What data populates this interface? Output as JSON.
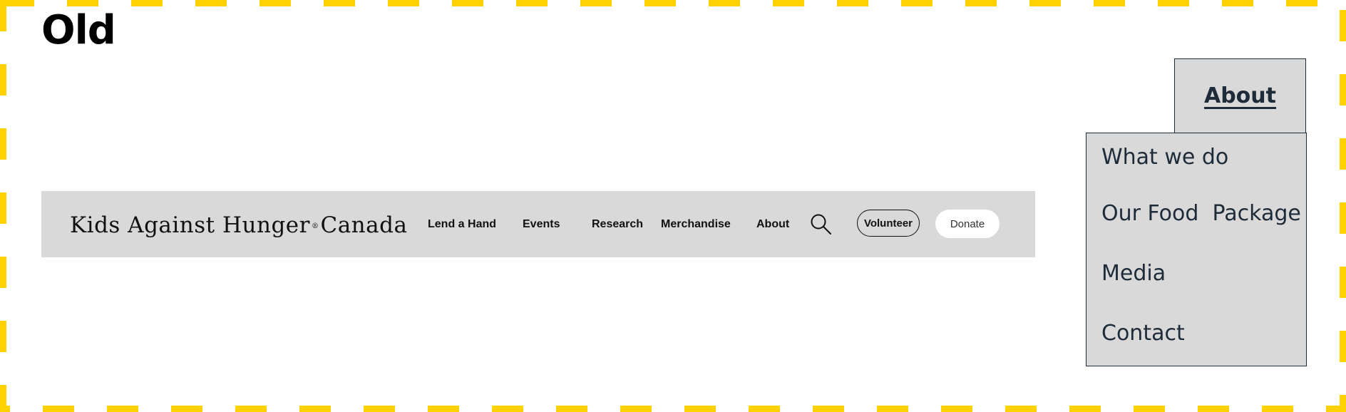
{
  "section_title": "Old",
  "navbar": {
    "logo_text_main": "Kids Against Hunger",
    "logo_mark": "®",
    "logo_text_country": "Canada",
    "links": [
      "Lend a Hand",
      "Events",
      "Research",
      "Merchandise",
      "About"
    ],
    "search_icon": "search-icon",
    "volunteer_label": "Volunteer",
    "donate_label": "Donate"
  },
  "about_menu": {
    "tab_label": "About",
    "items": [
      "What we do",
      "Our Food  Package",
      "Media",
      "Contact"
    ]
  },
  "colors": {
    "frame_dash": "#ffd100",
    "navbar_bg": "#d9d9d9",
    "menu_text": "#1e2b38",
    "donate_bg": "#ffffff"
  }
}
